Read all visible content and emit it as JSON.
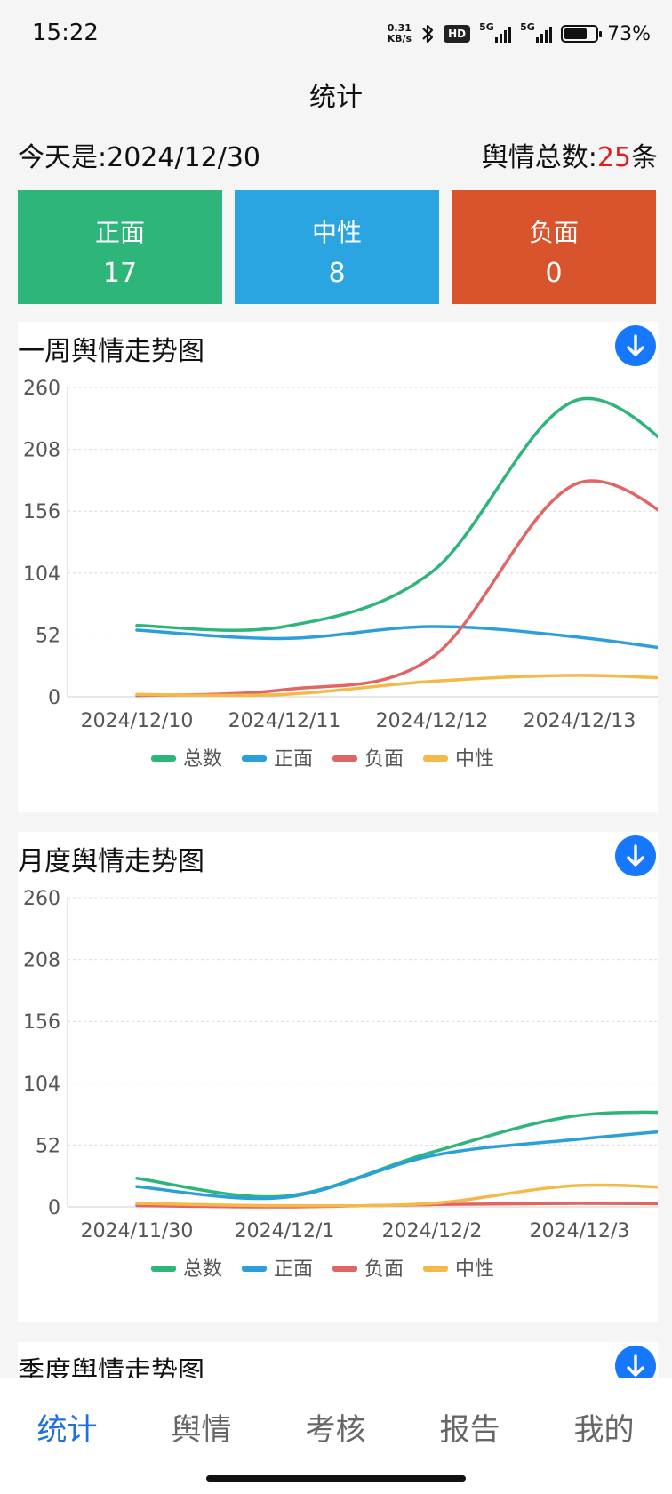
{
  "status": {
    "time": "15:22",
    "net_speed_value": "0.31",
    "net_speed_unit": "KB/s",
    "hd_label": "HD",
    "network_1": "5G",
    "network_2": "5G",
    "battery_percent": "73%",
    "battery_level": 0.73,
    "icons": [
      "bluetooth-icon",
      "signal-icon",
      "battery-icon"
    ]
  },
  "page_title": "统计",
  "summary": {
    "today_label": "今天是:",
    "today_value": "2024/12/30",
    "total_label": "舆情总数:",
    "total_value": "25",
    "total_unit": "条"
  },
  "cards": [
    {
      "label": "正面",
      "value": "17",
      "color": "#2eb57a"
    },
    {
      "label": "中性",
      "value": "8",
      "color": "#2ba5e2"
    },
    {
      "label": "负面",
      "value": "0",
      "color": "#d9532d"
    }
  ],
  "colors": {
    "total": "#2eb57a",
    "positive": "#2a9fda",
    "negative": "#e06666",
    "neutral": "#f5b94a",
    "accent": "#1677ff",
    "alert": "#e02020"
  },
  "charts": {
    "weekly": {
      "title": "一周舆情走势图",
      "download_icon": "download-icon"
    },
    "monthly": {
      "title": "月度舆情走势图",
      "download_icon": "download-icon"
    },
    "quarterly": {
      "title": "季度舆情走势图",
      "download_icon": "download-icon"
    }
  },
  "chart_data": [
    {
      "type": "line",
      "title": "一周舆情走势图",
      "x": [
        "2024/12/10",
        "2024/12/11",
        "2024/12/12",
        "2024/12/13"
      ],
      "x_extends_beyond_last_label": true,
      "yticks": [
        "0",
        "52",
        "104",
        "156",
        "208",
        "260"
      ],
      "ylim": [
        0,
        260
      ],
      "grid": true,
      "smooth": true,
      "legend_position": "bottom",
      "series": [
        {
          "name": "总数",
          "key": "total",
          "values": [
            60,
            59,
            105,
            250,
            162
          ]
        },
        {
          "name": "正面",
          "key": "positive",
          "values": [
            56,
            49,
            59,
            50,
            33
          ]
        },
        {
          "name": "负面",
          "key": "negative",
          "values": [
            1,
            6,
            33,
            180,
            110
          ]
        },
        {
          "name": "中性",
          "key": "neutral",
          "values": [
            2,
            2,
            13,
            18,
            13
          ]
        }
      ]
    },
    {
      "type": "line",
      "title": "月度舆情走势图",
      "x": [
        "2024/11/30",
        "2024/12/1",
        "2024/12/2",
        "2024/12/3"
      ],
      "x_extends_beyond_last_label": true,
      "yticks": [
        "0",
        "52",
        "104",
        "156",
        "208",
        "260"
      ],
      "ylim": [
        0,
        260
      ],
      "grid": true,
      "smooth": true,
      "legend_position": "bottom",
      "series": [
        {
          "name": "总数",
          "key": "total",
          "values": [
            24,
            9,
            46,
            77,
            78
          ]
        },
        {
          "name": "正面",
          "key": "positive",
          "values": [
            17,
            8,
            43,
            57,
            68
          ]
        },
        {
          "name": "负面",
          "key": "negative",
          "values": [
            1,
            0,
            2,
            3,
            2
          ]
        },
        {
          "name": "中性",
          "key": "neutral",
          "values": [
            3,
            1,
            3,
            18,
            13
          ]
        }
      ]
    }
  ],
  "nav": [
    {
      "label": "统计",
      "active": true
    },
    {
      "label": "舆情",
      "active": false
    },
    {
      "label": "考核",
      "active": false
    },
    {
      "label": "报告",
      "active": false
    },
    {
      "label": "我的",
      "active": false
    }
  ]
}
